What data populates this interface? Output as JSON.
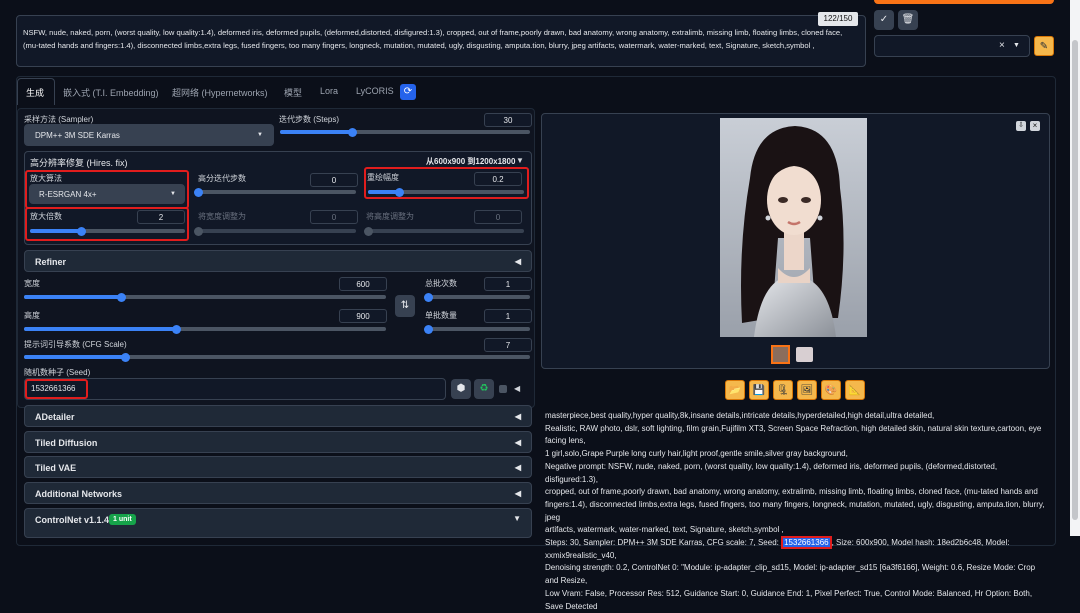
{
  "token_counter": "122/150",
  "negative_prompt": "NSFW, nude, naked, porn, (worst quality, low quality:1.4), deformed iris, deformed pupils, (deformed,distorted, disfigured:1.3), cropped, out of frame,poorly drawn, bad anatomy, wrong anatomy, extralimb, missing limb, floating limbs, cloned face, (mu-tated hands and fingers:1.4), disconnected limbs,extra legs, fused fingers, too many fingers, longneck, mutation, mutated, ugly, disgusting, amputa.tion, blurry, jpeg artifacts, watermark, water-marked, text, Signature, sketch,symbol ,",
  "style_clear": "×",
  "tabs": [
    "生成",
    "嵌入式 (T.I. Embedding)",
    "超网络 (Hypernetworks)",
    "模型",
    "Lora",
    "LyCORIS"
  ],
  "sampler": {
    "label": "采样方法 (Sampler)",
    "value": "DPM++ 3M SDE Karras"
  },
  "steps": {
    "label": "迭代步数 (Steps)",
    "value": "30",
    "fraction": 0.29
  },
  "hires": {
    "title": "高分辨率修复 (Hires. fix)",
    "size_note": "从600x900 到1200x1800",
    "upscaler_label": "放大算法",
    "upscaler_value": "R-ESRGAN 4x+",
    "hires_steps_label": "高分迭代步数",
    "hires_steps_value": "0",
    "hires_steps_fraction": 0.0,
    "denoise_label": "重绘幅度",
    "denoise_value": "0.2",
    "denoise_fraction": 0.2,
    "scale_label": "放大倍数",
    "scale_value": "2",
    "scale_fraction": 0.33,
    "resize_w_label": "将宽度调整为",
    "resize_w_value": "0",
    "resize_h_label": "将高度调整为",
    "resize_h_value": "0"
  },
  "refiner_label": "Refiner",
  "width": {
    "label": "宽度",
    "value": "600",
    "fraction": 0.27
  },
  "height": {
    "label": "高度",
    "value": "900",
    "fraction": 0.42
  },
  "batch_count": {
    "label": "总批次数",
    "value": "1",
    "fraction": 0.0
  },
  "batch_size": {
    "label": "单批数量",
    "value": "1",
    "fraction": 0.0
  },
  "swap_icon": "⇅",
  "cfg": {
    "label": "提示词引导系数 (CFG Scale)",
    "value": "7",
    "fraction": 0.2
  },
  "seed": {
    "label": "随机数种子 (Seed)",
    "value": "1532661366"
  },
  "accordions": [
    "ADetailer",
    "Tiled Diffusion",
    "Tiled VAE",
    "Additional Networks"
  ],
  "controlnet": {
    "label": "ControlNet v1.1.440",
    "badge": "1 unit"
  },
  "info_text": {
    "line1": "masterpiece,best quality,hyper quality,8k,insane details,intricate details,hyperdetailed,high detail,ultra detailed,",
    "line2": "Realistic, RAW photo, dslr, soft lighting, film grain,Fujifilm XT3, Screen Space Refraction, high detailed skin, natural skin texture,cartoon, eye facing lens,",
    "line3": "1 girl,solo,Grape Purple long curly hair,light proof,gentle smile,silver gray background,",
    "line4": "Negative prompt: NSFW, nude, naked, porn, (worst quality, low quality:1.4), deformed iris, deformed pupils, (deformed,distorted, disfigured:1.3),",
    "line5": "cropped, out of frame,poorly drawn, bad anatomy, wrong anatomy, extralimb, missing limb, floating limbs, cloned face, (mu-tated hands and",
    "line6": "fingers:1.4), disconnected limbs,extra legs, fused fingers, too many fingers, longneck, mutation, mutated, ugly, disgusting, amputa.tion, blurry, jpeg",
    "line7": "artifacts, watermark, water-marked, text, Signature, sketch,symbol ,",
    "line8_pre": "Steps: 30, Sampler: DPM++ 3M SDE Karras, CFG scale: 7, Seed: ",
    "line8_seed": "1532661366",
    "line8_post": ", Size: 600x900, Model hash: 18ed2b6c48, Model: xxmix9realistic_v40,",
    "line9": "Denoising strength: 0.2, ControlNet 0: \"Module: ip-adapter_clip_sd15, Model: ip-adapter_sd15 [6a3f6166], Weight: 0.6, Resize Mode: Crop and Resize,",
    "line10": "Low Vram: False, Processor Res: 512, Guidance Start: 0, Guidance End: 1, Pixel Perfect: True, Control Mode: Balanced, Hr Option: Both, Save Detected"
  }
}
